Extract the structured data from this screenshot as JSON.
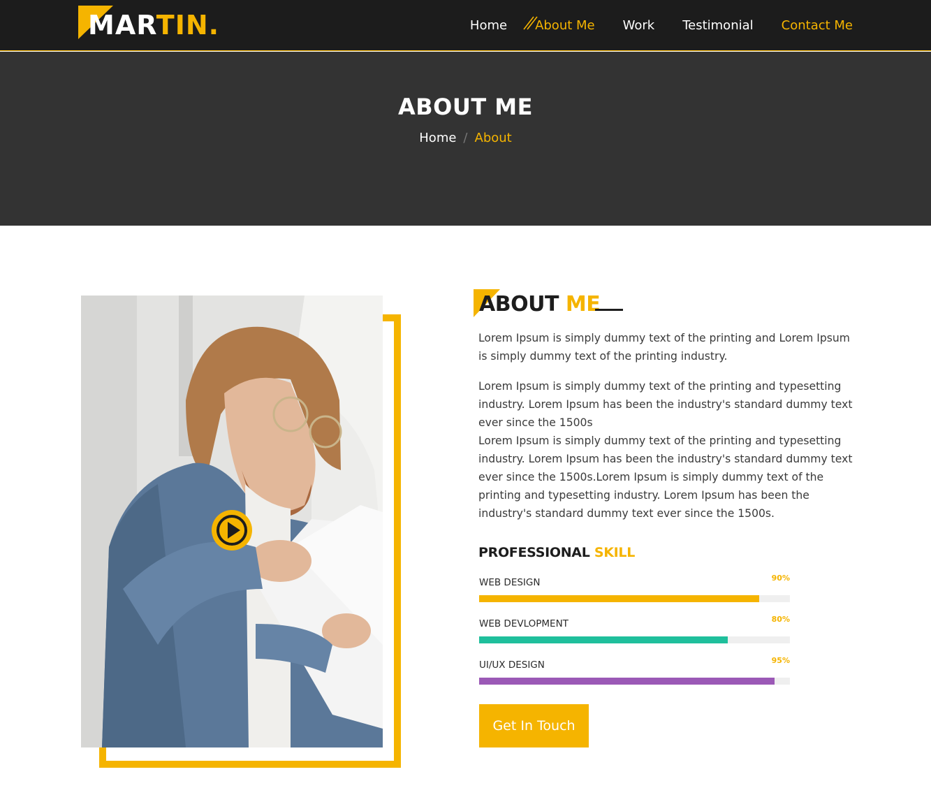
{
  "logo": {
    "part1": "MAR",
    "part2": "TIN",
    "dot": "."
  },
  "nav": {
    "items": [
      {
        "label": "Home",
        "active": false
      },
      {
        "label": "About Me",
        "active": true
      },
      {
        "label": "Work",
        "active": false
      },
      {
        "label": "Testimonial",
        "active": false
      },
      {
        "label": "Contact Me",
        "active": false
      }
    ]
  },
  "banner": {
    "title": "ABOUT ME",
    "breadcrumb": {
      "home": "Home",
      "separator": "/",
      "current": "About"
    }
  },
  "about": {
    "title_dark": "ABOUT ",
    "title_accent": "ME",
    "paragraph1": "Lorem Ipsum is simply dummy text of the printing and Lorem Ipsum is simply dummy text of the printing industry.",
    "paragraph2a": "Lorem Ipsum is simply dummy text of the printing and typesetting industry. Lorem Ipsum has been the industry's standard dummy text ever since the 1500s",
    "paragraph2b": "Lorem Ipsum is simply dummy text of the printing and typesetting industry. Lorem Ipsum has been the industry's standard dummy text ever since the 1500s.Lorem Ipsum is simply dummy text of the printing and typesetting industry. Lorem Ipsum has been the industry's standard dummy text ever since the 1500s."
  },
  "skills": {
    "title_dark": "PROFESSIONAL ",
    "title_accent": "SKILL",
    "items": [
      {
        "label": "WEB DESIGN",
        "percent": "90%",
        "value": 0.9,
        "color": "#f5b400"
      },
      {
        "label": "WEB DEVLOPMENT",
        "percent": "80%",
        "value": 0.8,
        "color": "#1fbf9c"
      },
      {
        "label": "UI/UX DESIGN",
        "percent": "95%",
        "value": 0.95,
        "color": "#9b59b6"
      }
    ]
  },
  "cta": {
    "label": "Get In Touch"
  },
  "colors": {
    "accent": "#f5b400",
    "header": "#1c1c1c",
    "banner": "#333333"
  }
}
